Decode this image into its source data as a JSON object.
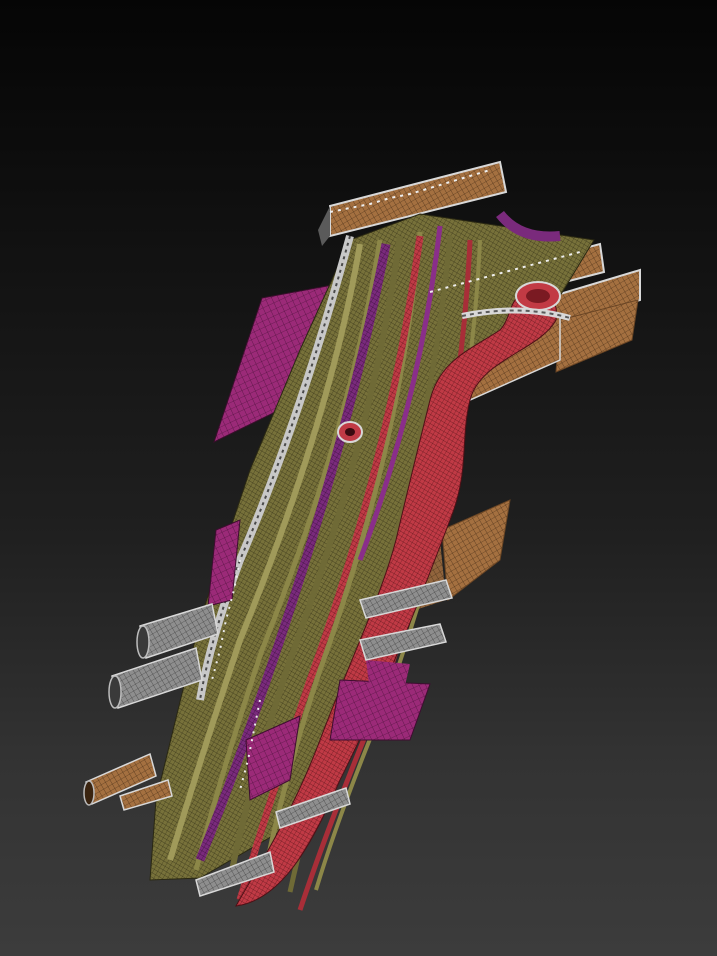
{
  "viewport": {
    "background_top": "#050505",
    "background_bottom": "#3c3c3c"
  },
  "model": {
    "description_icon": "wireframe-mesh-sculpt",
    "colors": {
      "tan": "#a47040",
      "tan_dark": "#6a4524",
      "olive": "#6f6a36",
      "olive_light": "#8c8748",
      "purple": "#7a2a7c",
      "magenta": "#9b2a78",
      "red": "#b8323d",
      "red_light": "#d24652",
      "grey": "#9a9a9a",
      "grey_dark": "#5a5a5a",
      "white_edge": "#d8d8d8"
    }
  }
}
